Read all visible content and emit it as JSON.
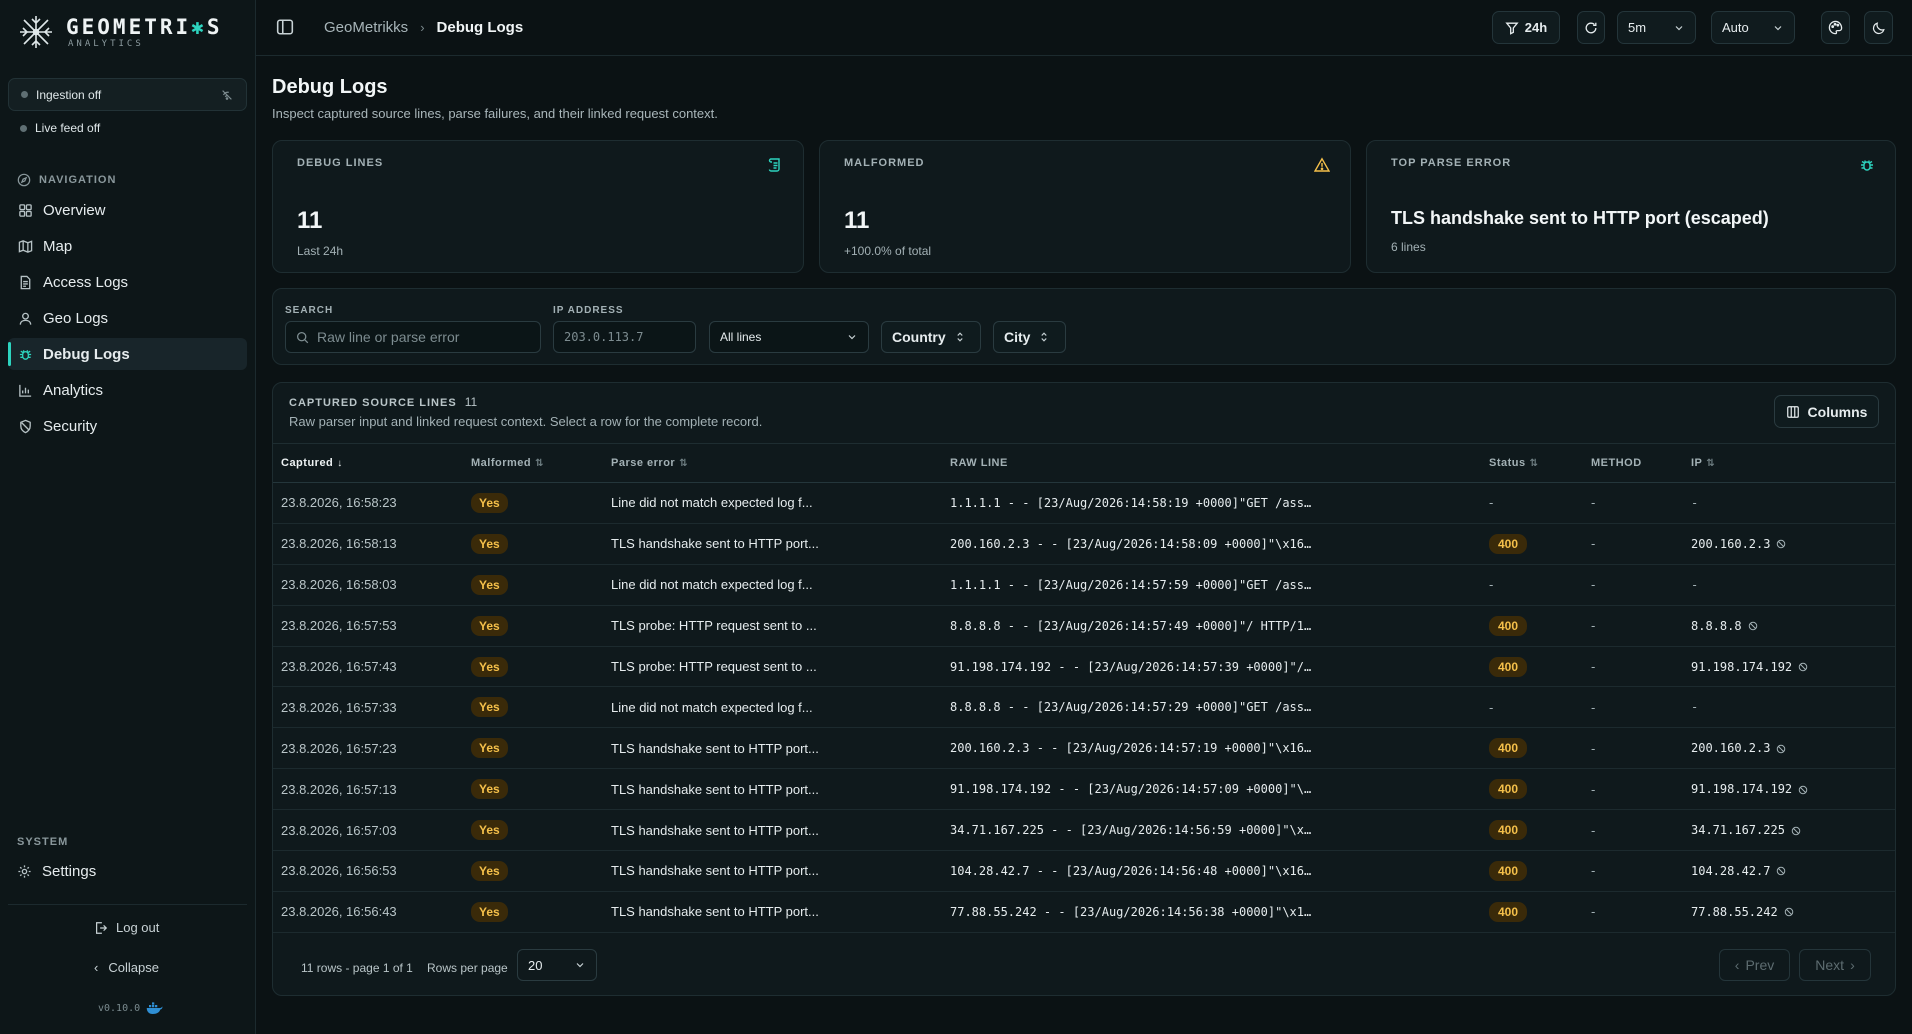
{
  "brand": {
    "name_prefix": "GEOMETRI",
    "name_accent": "✱",
    "name_suffix": "S",
    "subtitle": "ANALYTICS"
  },
  "sidebar": {
    "ingestion": "Ingestion off",
    "live_feed": "Live feed off",
    "nav_label": "NAVIGATION",
    "items": [
      {
        "label": "Overview",
        "icon": "grid-icon"
      },
      {
        "label": "Map",
        "icon": "map-icon"
      },
      {
        "label": "Access Logs",
        "icon": "file-icon"
      },
      {
        "label": "Geo Logs",
        "icon": "user-pin-icon"
      },
      {
        "label": "Debug Logs",
        "icon": "bug-icon",
        "active": true
      },
      {
        "label": "Analytics",
        "icon": "bar-chart-icon"
      },
      {
        "label": "Security",
        "icon": "shield-icon"
      }
    ],
    "system_label": "SYSTEM",
    "settings": "Settings",
    "logout": "Log out",
    "collapse": "Collapse",
    "version": "v0.10.0"
  },
  "topbar": {
    "crumb_root": "GeoMetrikks",
    "crumb_current": "Debug Logs",
    "time_range": "24h",
    "refresh_interval": "5m",
    "theme_mode": "Auto"
  },
  "page": {
    "title": "Debug Logs",
    "subtitle": "Inspect captured source lines, parse failures, and their linked request context."
  },
  "cards": {
    "debug_lines": {
      "label": "DEBUG LINES",
      "value": "11",
      "note": "Last 24h"
    },
    "malformed": {
      "label": "MALFORMED",
      "value": "11",
      "note": "+100.0% of total"
    },
    "top_error": {
      "label": "TOP PARSE ERROR",
      "value": "TLS handshake sent to HTTP port (escaped)",
      "note": "6 lines"
    }
  },
  "filters": {
    "search_label": "SEARCH",
    "search_placeholder": "Raw line or parse error",
    "ip_label": "IP ADDRESS",
    "ip_placeholder": "203.0.113.7",
    "lines_select": "All lines",
    "country": "Country",
    "city": "City"
  },
  "table": {
    "title": "CAPTURED SOURCE LINES",
    "count": "11",
    "subtitle": "Raw parser input and linked request context. Select a row for the complete record.",
    "columns_btn": "Columns",
    "headers": {
      "captured": "Captured",
      "malformed": "Malformed",
      "parse_error": "Parse error",
      "raw_line": "RAW LINE",
      "status": "Status",
      "method": "METHOD",
      "ip": "IP"
    },
    "rows": [
      {
        "captured": "23.8.2026, 16:58:23",
        "malformed": "Yes",
        "error": "Line did not match expected log f...",
        "raw": "1.1.1.1 - - [23/Aug/2026:14:58:19 +0000]\"GET /ass…",
        "status": "-",
        "method": "-",
        "ip": "-"
      },
      {
        "captured": "23.8.2026, 16:58:13",
        "malformed": "Yes",
        "error": "TLS handshake sent to HTTP port...",
        "raw": "200.160.2.3 - - [23/Aug/2026:14:58:09 +0000]\"\\x16…",
        "status": "400",
        "method": "-",
        "ip": "200.160.2.3"
      },
      {
        "captured": "23.8.2026, 16:58:03",
        "malformed": "Yes",
        "error": "Line did not match expected log f...",
        "raw": "1.1.1.1 - - [23/Aug/2026:14:57:59 +0000]\"GET /ass…",
        "status": "-",
        "method": "-",
        "ip": "-"
      },
      {
        "captured": "23.8.2026, 16:57:53",
        "malformed": "Yes",
        "error": "TLS probe: HTTP request sent to ...",
        "raw": "8.8.8.8 - - [23/Aug/2026:14:57:49 +0000]\"/ HTTP/1…",
        "status": "400",
        "method": "-",
        "ip": "8.8.8.8"
      },
      {
        "captured": "23.8.2026, 16:57:43",
        "malformed": "Yes",
        "error": "TLS probe: HTTP request sent to ...",
        "raw": "91.198.174.192 - - [23/Aug/2026:14:57:39 +0000]\"/…",
        "status": "400",
        "method": "-",
        "ip": "91.198.174.192"
      },
      {
        "captured": "23.8.2026, 16:57:33",
        "malformed": "Yes",
        "error": "Line did not match expected log f...",
        "raw": "8.8.8.8 - - [23/Aug/2026:14:57:29 +0000]\"GET /ass…",
        "status": "-",
        "method": "-",
        "ip": "-"
      },
      {
        "captured": "23.8.2026, 16:57:23",
        "malformed": "Yes",
        "error": "TLS handshake sent to HTTP port...",
        "raw": "200.160.2.3 - - [23/Aug/2026:14:57:19 +0000]\"\\x16…",
        "status": "400",
        "method": "-",
        "ip": "200.160.2.3"
      },
      {
        "captured": "23.8.2026, 16:57:13",
        "malformed": "Yes",
        "error": "TLS handshake sent to HTTP port...",
        "raw": "91.198.174.192 - - [23/Aug/2026:14:57:09 +0000]\"\\…",
        "status": "400",
        "method": "-",
        "ip": "91.198.174.192"
      },
      {
        "captured": "23.8.2026, 16:57:03",
        "malformed": "Yes",
        "error": "TLS handshake sent to HTTP port...",
        "raw": "34.71.167.225 - - [23/Aug/2026:14:56:59 +0000]\"\\x…",
        "status": "400",
        "method": "-",
        "ip": "34.71.167.225"
      },
      {
        "captured": "23.8.2026, 16:56:53",
        "malformed": "Yes",
        "error": "TLS handshake sent to HTTP port...",
        "raw": "104.28.42.7 - - [23/Aug/2026:14:56:48 +0000]\"\\x16…",
        "status": "400",
        "method": "-",
        "ip": "104.28.42.7"
      },
      {
        "captured": "23.8.2026, 16:56:43",
        "malformed": "Yes",
        "error": "TLS handshake sent to HTTP port...",
        "raw": "77.88.55.242 - - [23/Aug/2026:14:56:38 +0000]\"\\x1…",
        "status": "400",
        "method": "-",
        "ip": "77.88.55.242"
      }
    ],
    "page_info": "11 rows - page 1 of 1",
    "rows_per_page_label": "Rows per page",
    "rows_per_page": "20",
    "prev": "Prev",
    "next": "Next"
  },
  "colors": {
    "accent": "#2dd4bf",
    "warning": "#f5c04a",
    "background": "#0b1214"
  }
}
